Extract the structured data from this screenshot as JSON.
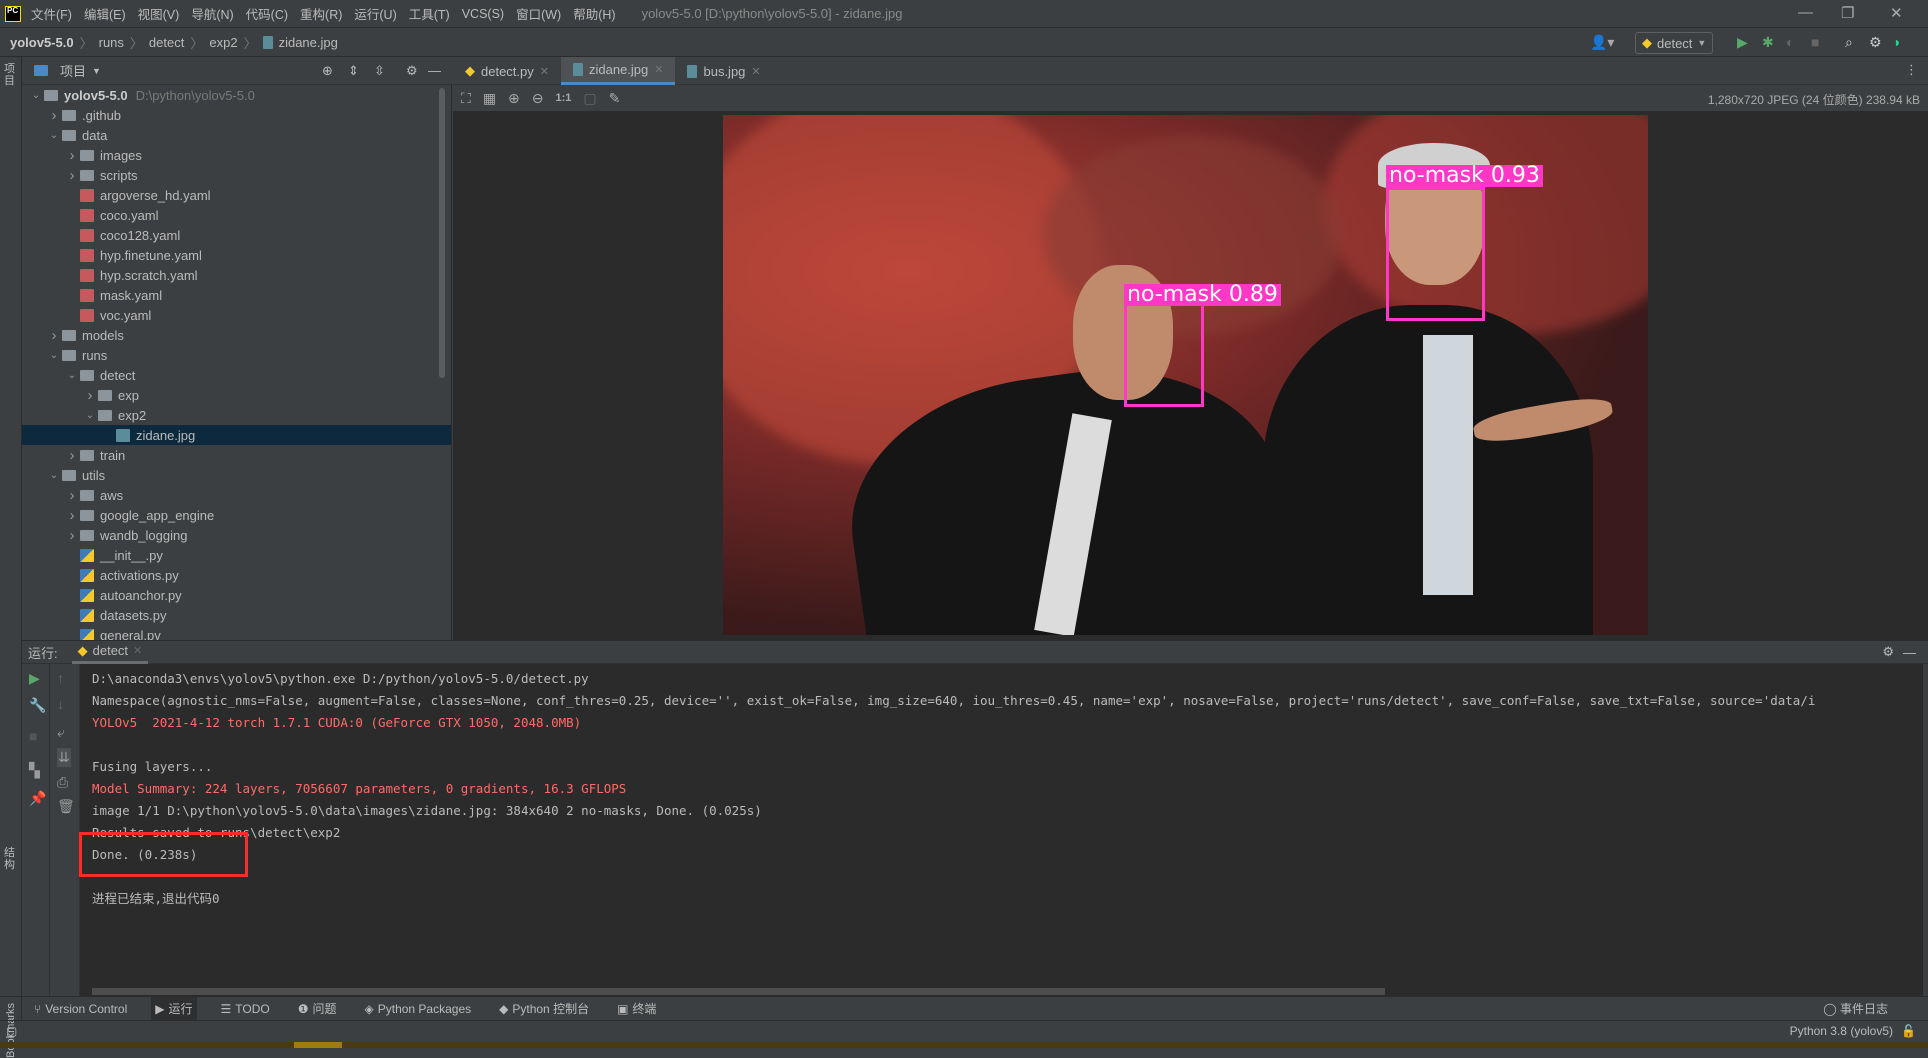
{
  "app": {
    "logo": "PC",
    "window_title": "yolov5-5.0 [D:\\python\\yolov5-5.0] - zidane.jpg",
    "menu": [
      "文件(F)",
      "编辑(E)",
      "视图(V)",
      "导航(N)",
      "代码(C)",
      "重构(R)",
      "运行(U)",
      "工具(T)",
      "VCS(S)",
      "窗口(W)",
      "帮助(H)"
    ]
  },
  "breadcrumb": [
    "yolov5-5.0",
    "runs",
    "detect",
    "exp2",
    "zidane.jpg"
  ],
  "toolbar": {
    "run_config": "detect"
  },
  "left_strip": {
    "project": "项目",
    "structure": "结构",
    "bookmarks": "Bookmarks"
  },
  "project": {
    "title": "项目",
    "tree": [
      {
        "label": "yolov5-5.0",
        "hint": "D:\\python\\yolov5-5.0",
        "depth": 0,
        "state": "open",
        "icon": "folder",
        "bold": true
      },
      {
        "label": ".github",
        "depth": 1,
        "state": "closed",
        "icon": "folder"
      },
      {
        "label": "data",
        "depth": 1,
        "state": "open",
        "icon": "folder"
      },
      {
        "label": "images",
        "depth": 2,
        "state": "closed",
        "icon": "folder"
      },
      {
        "label": "scripts",
        "depth": 2,
        "state": "closed",
        "icon": "folder"
      },
      {
        "label": "argoverse_hd.yaml",
        "depth": 2,
        "icon": "yml"
      },
      {
        "label": "coco.yaml",
        "depth": 2,
        "icon": "yml"
      },
      {
        "label": "coco128.yaml",
        "depth": 2,
        "icon": "yml"
      },
      {
        "label": "hyp.finetune.yaml",
        "depth": 2,
        "icon": "yml"
      },
      {
        "label": "hyp.scratch.yaml",
        "depth": 2,
        "icon": "yml"
      },
      {
        "label": "mask.yaml",
        "depth": 2,
        "icon": "yml"
      },
      {
        "label": "voc.yaml",
        "depth": 2,
        "icon": "yml"
      },
      {
        "label": "models",
        "depth": 1,
        "state": "closed",
        "icon": "folder"
      },
      {
        "label": "runs",
        "depth": 1,
        "state": "open",
        "icon": "folder"
      },
      {
        "label": "detect",
        "depth": 2,
        "state": "open",
        "icon": "folder"
      },
      {
        "label": "exp",
        "depth": 3,
        "state": "closed",
        "icon": "folder"
      },
      {
        "label": "exp2",
        "depth": 3,
        "state": "open",
        "icon": "folder"
      },
      {
        "label": "zidane.jpg",
        "depth": 4,
        "icon": "img",
        "selected": true
      },
      {
        "label": "train",
        "depth": 2,
        "state": "closed",
        "icon": "folder"
      },
      {
        "label": "utils",
        "depth": 1,
        "state": "open",
        "icon": "folder"
      },
      {
        "label": "aws",
        "depth": 2,
        "state": "closed",
        "icon": "folder"
      },
      {
        "label": "google_app_engine",
        "depth": 2,
        "state": "closed",
        "icon": "folder"
      },
      {
        "label": "wandb_logging",
        "depth": 2,
        "state": "closed",
        "icon": "folder"
      },
      {
        "label": "__init__.py",
        "depth": 2,
        "icon": "py"
      },
      {
        "label": "activations.py",
        "depth": 2,
        "icon": "py"
      },
      {
        "label": "autoanchor.py",
        "depth": 2,
        "icon": "py"
      },
      {
        "label": "datasets.py",
        "depth": 2,
        "icon": "py"
      },
      {
        "label": "general.py",
        "depth": 2,
        "icon": "py"
      }
    ]
  },
  "editor": {
    "tabs": [
      {
        "label": "detect.py",
        "icon": "python"
      },
      {
        "label": "zidane.jpg",
        "icon": "image",
        "active": true
      },
      {
        "label": "bus.jpg",
        "icon": "image"
      }
    ],
    "image_info": "1,280x720 JPEG (24 位颜色) 238.94 kB",
    "image_tools": {
      "zoom_actual": "1:1"
    },
    "detections": [
      {
        "label": "no-mask 0.89",
        "class": "no-mask",
        "confidence": 0.89
      },
      {
        "label": "no-mask 0.93",
        "class": "no-mask",
        "confidence": 0.93
      }
    ],
    "box_color": "#ff37c7"
  },
  "run": {
    "label": "运行:",
    "tab": "detect",
    "lines": [
      {
        "text": "D:\\anaconda3\\envs\\yolov5\\python.exe D:/python/yolov5-5.0/detect.py",
        "color": "normal"
      },
      {
        "text": "Namespace(agnostic_nms=False, augment=False, classes=None, conf_thres=0.25, device='', exist_ok=False, img_size=640, iou_thres=0.45, name='exp', nosave=False, project='runs/detect', save_conf=False, save_txt=False, source='data/i",
        "color": "normal"
      },
      {
        "text": "YOLOv5  2021-4-12 torch 1.7.1 CUDA:0 (GeForce GTX 1050, 2048.0MB)",
        "color": "red"
      },
      {
        "text": "",
        "color": "normal"
      },
      {
        "text": "Fusing layers...",
        "color": "normal"
      },
      {
        "text": "Model Summary: 224 layers, 7056607 parameters, 0 gradients, 16.3 GFLOPS",
        "color": "red"
      },
      {
        "text": "image 1/1 D:\\python\\yolov5-5.0\\data\\images\\zidane.jpg: 384x640 2 no-masks, Done. (0.025s)",
        "color": "normal"
      },
      {
        "text": "Results saved to runs\\detect\\exp2",
        "color": "normal"
      },
      {
        "text": "Done. (0.238s)",
        "color": "normal"
      },
      {
        "text": "",
        "color": "normal"
      },
      {
        "text": "进程已结束,退出代码0",
        "color": "normal"
      }
    ]
  },
  "bottom_tools": [
    "Version Control",
    "运行",
    "TODO",
    "问题",
    "Python Packages",
    "Python 控制台",
    "终端"
  ],
  "event_log": "事件日志",
  "status": {
    "interpreter": "Python 3.8 (yolov5)"
  }
}
